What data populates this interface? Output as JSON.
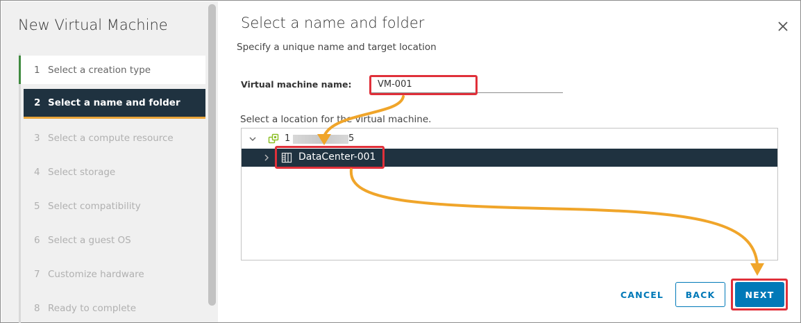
{
  "wizard": {
    "title": "New Virtual Machine",
    "steps": [
      {
        "num": "1",
        "label": "Select a creation type",
        "state": "done"
      },
      {
        "num": "2",
        "label": "Select a name and folder",
        "state": "active"
      },
      {
        "num": "3",
        "label": "Select a compute resource",
        "state": "pending"
      },
      {
        "num": "4",
        "label": "Select storage",
        "state": "pending"
      },
      {
        "num": "5",
        "label": "Select compatibility",
        "state": "pending"
      },
      {
        "num": "6",
        "label": "Select a guest OS",
        "state": "pending"
      },
      {
        "num": "7",
        "label": "Customize hardware",
        "state": "pending"
      },
      {
        "num": "8",
        "label": "Ready to complete",
        "state": "pending"
      }
    ]
  },
  "main": {
    "title": "Select a name and folder",
    "subtitle": "Specify a unique name and target location",
    "vm_name_label": "Virtual machine name:",
    "vm_name_value": "VM-001",
    "location_label": "Select a location for the virtual machine.",
    "tree": {
      "root_prefix": "1",
      "root_suffix": "5",
      "child_label": "DataCenter-001"
    }
  },
  "buttons": {
    "cancel": "CANCEL",
    "back": "BACK",
    "next": "NEXT"
  },
  "colors": {
    "accent": "#0079b8",
    "selected_bg": "#1f3240",
    "active_underline": "#e9a53a",
    "highlight": "#e0303a",
    "arrow": "#f0a52a"
  }
}
